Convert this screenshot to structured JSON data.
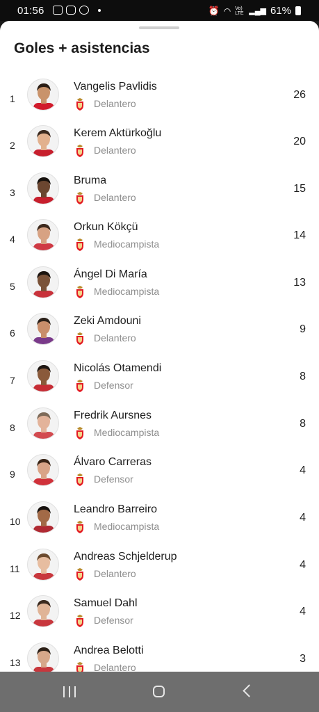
{
  "status_bar": {
    "time": "01:56",
    "battery": "61%",
    "network": "Vo) LTE"
  },
  "page": {
    "title": "Goles + asistencias"
  },
  "colors": {
    "accent": "#e31b23",
    "muted_text": "#8d8d8d"
  },
  "players": [
    {
      "rank": "1",
      "name": "Vangelis Pavlidis",
      "position": "Delantero",
      "value": "26"
    },
    {
      "rank": "2",
      "name": "Kerem Aktürkoğlu",
      "position": "Delantero",
      "value": "20"
    },
    {
      "rank": "3",
      "name": "Bruma",
      "position": "Delantero",
      "value": "15"
    },
    {
      "rank": "4",
      "name": "Orkun Kökçü",
      "position": "Mediocampista",
      "value": "14"
    },
    {
      "rank": "5",
      "name": "Ángel Di María",
      "position": "Mediocampista",
      "value": "13"
    },
    {
      "rank": "6",
      "name": "Zeki Amdouni",
      "position": "Delantero",
      "value": "9"
    },
    {
      "rank": "7",
      "name": "Nicolás Otamendi",
      "position": "Defensor",
      "value": "8"
    },
    {
      "rank": "8",
      "name": "Fredrik Aursnes",
      "position": "Mediocampista",
      "value": "8"
    },
    {
      "rank": "9",
      "name": "Álvaro Carreras",
      "position": "Defensor",
      "value": "4"
    },
    {
      "rank": "10",
      "name": "Leandro Barreiro",
      "position": "Mediocampista",
      "value": "4"
    },
    {
      "rank": "11",
      "name": "Andreas Schjelderup",
      "position": "Delantero",
      "value": "4"
    },
    {
      "rank": "12",
      "name": "Samuel Dahl",
      "position": "Defensor",
      "value": "4"
    },
    {
      "rank": "13",
      "name": "Andrea Belotti",
      "position": "Delantero",
      "value": "3"
    }
  ],
  "icons": {
    "avatar": "player-avatar",
    "crest": "club-crest-icon",
    "nav": [
      "recents-icon",
      "home-icon",
      "back-icon"
    ]
  }
}
